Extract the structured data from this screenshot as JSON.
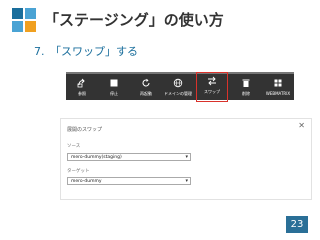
{
  "slide": {
    "title": "「ステージング」の使い方",
    "step": "7.　「スワップ」する",
    "page_number": "23"
  },
  "toolbar": {
    "buttons": [
      {
        "label": "参照",
        "icon": "browse-icon"
      },
      {
        "label": "停止",
        "icon": "stop-icon"
      },
      {
        "label": "再起動",
        "icon": "restart-icon"
      },
      {
        "label": "ドメインの管理",
        "icon": "globe-icon"
      },
      {
        "label": "スワップ",
        "icon": "swap-icon",
        "highlighted": true
      },
      {
        "label": "削除",
        "icon": "trash-icon"
      },
      {
        "label": "WEBMATRIX",
        "icon": "webmatrix-icon"
      }
    ],
    "highlight_color": "#d9322b"
  },
  "dialog": {
    "title": "展開のスワップ",
    "source_label": "ソース",
    "source_value": "mero-dummy(staging)",
    "target_label": "ターゲット",
    "target_value": "mero-dummy"
  }
}
